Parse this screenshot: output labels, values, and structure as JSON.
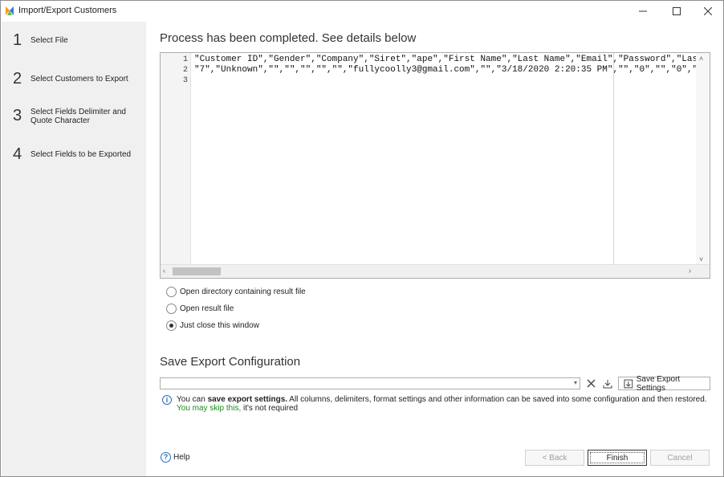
{
  "window": {
    "title": "Import/Export Customers",
    "icons": {
      "app": "app-logo-icon",
      "minimize": "minimize-icon",
      "maximize": "maximize-icon",
      "close": "close-icon"
    }
  },
  "sidebar": {
    "steps": [
      {
        "number": "1",
        "label": "Select File"
      },
      {
        "number": "2",
        "label": "Select Customers to Export"
      },
      {
        "number": "3",
        "label": "Select Fields Delimiter and Quote Character"
      },
      {
        "number": "4",
        "label": "Select Fields to be Exported"
      }
    ]
  },
  "main": {
    "title": "Process has been completed. See details below",
    "editor": {
      "lines": [
        {
          "number": "1",
          "text": "\"Customer ID\",\"Gender\",\"Company\",\"Siret\",\"ape\",\"First Name\",\"Last Name\",\"Email\",\"Password\",\"Last"
        },
        {
          "number": "2",
          "text": "\"7\",\"Unknown\",\"\",\"\",\"\",\"\",\"\",\"fullycoolly3@gmail.com\",\"\",\"3/18/2020 2:20:35 PM\",\"\",\"0\",\"\",\"0\",\"\""
        },
        {
          "number": "3",
          "text": ""
        }
      ]
    },
    "options": [
      {
        "label": "Open directory containing result file",
        "checked": false
      },
      {
        "label": "Open result file",
        "checked": false
      },
      {
        "label": "Just close this window",
        "checked": true
      }
    ]
  },
  "save_config": {
    "title": "Save Export Configuration",
    "combo_value": "",
    "save_button_label": "Save Export Settings",
    "info": {
      "prefix": "You can ",
      "bold": "save export settings.",
      "middle": " All columns, delimiters, format settings and other information can be saved into some configuration and then restored. ",
      "green": "You may skip this,",
      "suffix": " it's not required"
    }
  },
  "footer": {
    "help_label": "Help",
    "back_label": "< Back",
    "finish_label": "Finish",
    "cancel_label": "Cancel"
  },
  "colors": {
    "sidebar_bg": "#f0f0f0",
    "link_green": "#1b8c1b",
    "info_blue": "#2a6ebd"
  }
}
